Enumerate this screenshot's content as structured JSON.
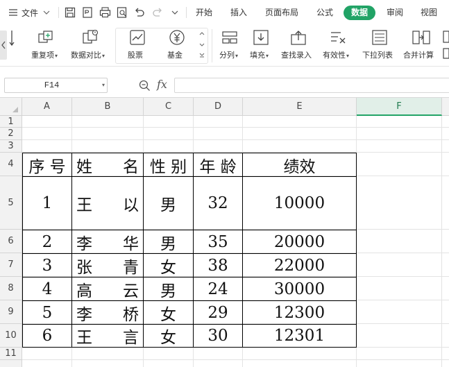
{
  "menubar": {
    "file_label": "文件",
    "tabs": [
      "开始",
      "插入",
      "页面布局",
      "公式",
      "数据",
      "审阅",
      "视图"
    ],
    "active_tab": "数据"
  },
  "ribbon": {
    "buttons": {
      "dedupe": "重复项",
      "compare": "数据对比",
      "stock": "股票",
      "fund": "基金",
      "split": "分列",
      "fill": "填充",
      "lookup": "查找录入",
      "validity": "有效性",
      "dropdown": "下拉列表",
      "consolidate": "合并计算"
    }
  },
  "formula_bar": {
    "name_box": "F14",
    "fx": "fx",
    "formula": ""
  },
  "sheet": {
    "columns": [
      "A",
      "B",
      "C",
      "D",
      "E",
      "F"
    ],
    "selected_column": "F",
    "rows": [
      "1",
      "2",
      "3",
      "4",
      "5",
      "6",
      "7",
      "8",
      "9",
      "10",
      "11"
    ],
    "table": {
      "headers": [
        "序 号",
        "姓 名",
        "性 别",
        "年 龄",
        "绩效"
      ],
      "header_name_parts": [
        "姓",
        "名"
      ],
      "rows": [
        {
          "no": "1",
          "name": [
            "王",
            "以"
          ],
          "gender": "男",
          "age": "32",
          "score": "10000"
        },
        {
          "no": "2",
          "name": [
            "李",
            "华"
          ],
          "gender": "男",
          "age": "35",
          "score": "20000"
        },
        {
          "no": "3",
          "name": [
            "张",
            "青"
          ],
          "gender": "女",
          "age": "38",
          "score": "22000"
        },
        {
          "no": "4",
          "name": [
            "高",
            "云"
          ],
          "gender": "男",
          "age": "24",
          "score": "30000"
        },
        {
          "no": "5",
          "name": [
            "李",
            "桥"
          ],
          "gender": "女",
          "age": "29",
          "score": "12300"
        },
        {
          "no": "6",
          "name": [
            "王",
            "言"
          ],
          "gender": "女",
          "age": "30",
          "score": "12301"
        }
      ]
    }
  },
  "colors": {
    "accent": "#21a366",
    "header_bg": "#f2f2f2",
    "gridline": "#e3e3e3"
  }
}
